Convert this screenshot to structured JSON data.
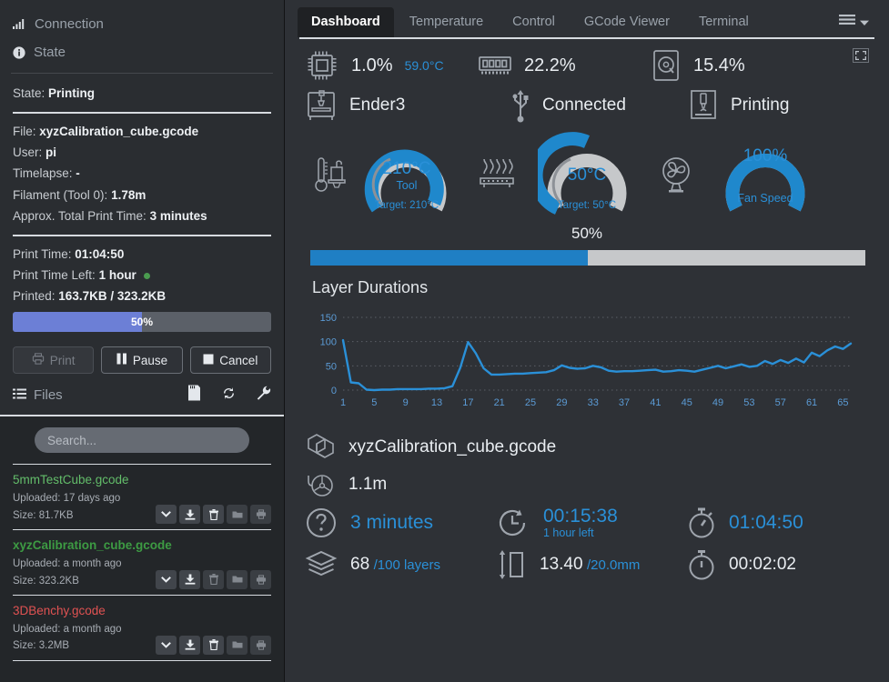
{
  "sidebar": {
    "connection_label": "Connection",
    "state_label": "State",
    "state": {
      "key": "State:",
      "value": "Printing"
    },
    "details": [
      {
        "key": "File:",
        "value": "xyzCalibration_cube.gcode"
      },
      {
        "key": "User:",
        "value": "pi"
      },
      {
        "key": "Timelapse:",
        "value": "-"
      },
      {
        "key": "Filament (Tool 0):",
        "value": "1.78m"
      },
      {
        "key": "Approx. Total Print Time:",
        "value": "3 minutes"
      }
    ],
    "times": [
      {
        "key": "Print Time:",
        "value": "01:04:50",
        "dot": false
      },
      {
        "key": "Print Time Left:",
        "value": "1 hour",
        "dot": true
      },
      {
        "key": "Printed:",
        "value": "163.7KB / 323.2KB",
        "dot": false
      }
    ],
    "progress": {
      "percent": 50,
      "label": "50%",
      "color": "#6c7fd6"
    },
    "buttons": {
      "print": "Print",
      "pause": "Pause",
      "cancel": "Cancel"
    },
    "files": {
      "title": "Files",
      "search_placeholder": "Search...",
      "search_value": "",
      "items": [
        {
          "name": "5mmTestCube.gcode",
          "uploaded": "Uploaded: 17 days ago",
          "size": "Size: 81.7KB",
          "color": "green",
          "bold": false
        },
        {
          "name": "xyzCalibration_cube.gcode",
          "uploaded": "Uploaded: a month ago",
          "size": "Size: 323.2KB",
          "color": "green",
          "bold": true
        },
        {
          "name": "3DBenchy.gcode",
          "uploaded": "Uploaded: a month ago",
          "size": "Size: 3.2MB",
          "color": "red",
          "bold": false
        }
      ]
    }
  },
  "main": {
    "tabs": [
      {
        "label": "Dashboard",
        "active": true
      },
      {
        "label": "Temperature",
        "active": false
      },
      {
        "label": "Control",
        "active": false
      },
      {
        "label": "GCode Viewer",
        "active": false
      },
      {
        "label": "Terminal",
        "active": false
      }
    ],
    "system_stats": [
      {
        "icon": "cpu-icon",
        "value": "1.0%",
        "sub": "59.0°C"
      },
      {
        "icon": "memory-icon",
        "value": "22.2%",
        "sub": ""
      },
      {
        "icon": "disk-icon",
        "value": "15.4%",
        "sub": ""
      }
    ],
    "printer_status": [
      {
        "icon": "printer-icon",
        "value": "Ender3"
      },
      {
        "icon": "usb-icon",
        "value": "Connected"
      },
      {
        "icon": "extruding-icon",
        "value": "Printing"
      }
    ],
    "gauges": [
      {
        "icon": "thermometer-tool-icon",
        "value": "210°C",
        "name": "Tool",
        "target": "Target: 210°C",
        "percent": 100
      },
      {
        "icon": "heated-bed-icon",
        "value": "50°C",
        "name": "",
        "target": "Target: 50°C",
        "percent": 50
      },
      {
        "icon": "fan-icon",
        "value": "100%",
        "name": "Fan Speed",
        "target": "",
        "percent": 100
      }
    ],
    "progress": {
      "label": "50%",
      "percent": 50
    },
    "job": {
      "file_name": "xyzCalibration_cube.gcode",
      "filament": "1.1m",
      "estimate": "3 minutes",
      "elapsed_eta": "00:15:38",
      "eta_sub": "1 hour left",
      "print_time": "01:04:50",
      "layer_current": "68",
      "layer_total": "/100 layers",
      "height_current": "13.40",
      "height_total": "/20.0mm",
      "layer_time": "00:02:02"
    },
    "colors": {
      "accent_blue": "#2a90d8",
      "progress_purple": "#6c7fd6",
      "gauge_gray": "#c6c8ca"
    }
  },
  "chart_data": {
    "type": "line",
    "title": "Layer Durations",
    "xlabel": "",
    "ylabel": "",
    "ylim": [
      0,
      165
    ],
    "yticks": [
      0,
      50,
      100,
      150
    ],
    "xticks": [
      1,
      5,
      9,
      13,
      17,
      21,
      25,
      29,
      33,
      37,
      41,
      45,
      49,
      53,
      57,
      61,
      65
    ],
    "grid": true,
    "line_color": "#2a90d8",
    "x": [
      1,
      2,
      3,
      4,
      5,
      6,
      7,
      8,
      9,
      10,
      11,
      12,
      13,
      14,
      15,
      16,
      17,
      18,
      19,
      20,
      21,
      22,
      23,
      24,
      25,
      26,
      27,
      28,
      29,
      30,
      31,
      32,
      33,
      34,
      35,
      36,
      37,
      38,
      39,
      40,
      41,
      42,
      43,
      44,
      45,
      46,
      47,
      48,
      49,
      50,
      51,
      52,
      53,
      54,
      55,
      56,
      57,
      58,
      59,
      60,
      61,
      62,
      63,
      64,
      65,
      66
    ],
    "values": [
      103,
      16,
      14,
      1,
      0,
      1,
      1,
      2,
      2,
      2,
      2,
      3,
      3,
      4,
      8,
      46,
      99,
      76,
      45,
      32,
      32,
      33,
      34,
      34,
      35,
      36,
      37,
      41,
      51,
      46,
      44,
      45,
      50,
      47,
      40,
      38,
      39,
      39,
      40,
      41,
      42,
      38,
      39,
      41,
      40,
      38,
      42,
      46,
      50,
      45,
      49,
      53,
      48,
      50,
      60,
      54,
      62,
      56,
      65,
      57,
      77,
      70,
      82,
      90,
      85,
      96,
      90
    ]
  }
}
